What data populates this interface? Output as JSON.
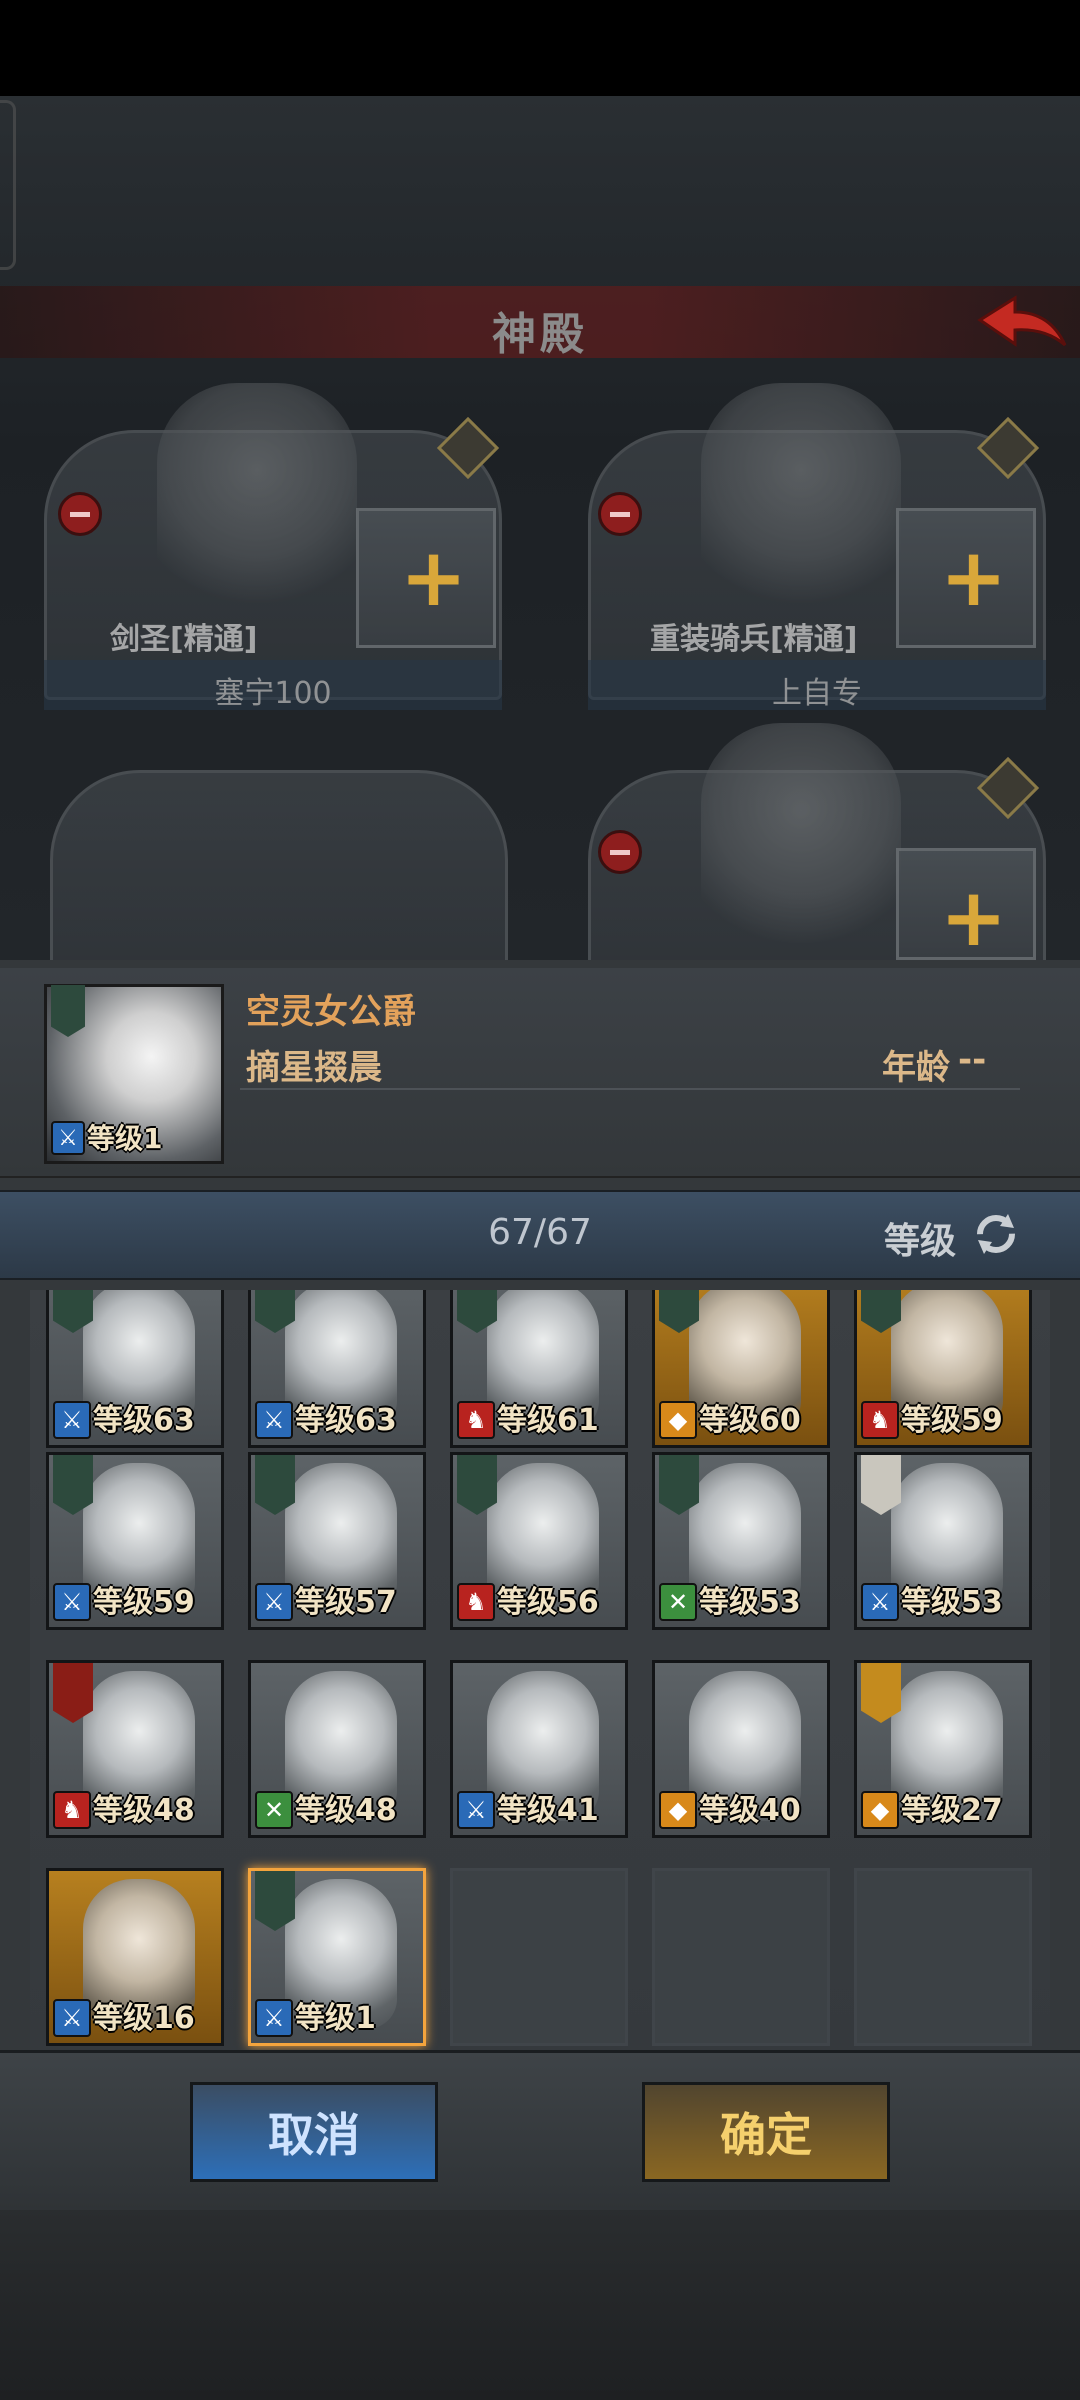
{
  "scene": {
    "title": "神殿",
    "slots": [
      {
        "class_label": "剑圣[精通]",
        "owner": "塞宁100"
      },
      {
        "class_label": "重装骑兵[精通]",
        "owner": "上自专"
      }
    ]
  },
  "selected_hero": {
    "name": "空灵女公爵",
    "title": "摘星掇晨",
    "age_label": "年龄",
    "age_value": "--",
    "level_text": "等级1"
  },
  "list_header": {
    "count": "67/67",
    "sort_label": "等级"
  },
  "heroes": [
    {
      "level": "等级63",
      "class": "sword",
      "bg": "grey",
      "banner": "green",
      "selected": false
    },
    {
      "level": "等级63",
      "class": "sword",
      "bg": "grey",
      "banner": "green",
      "selected": false
    },
    {
      "level": "等级61",
      "class": "horse",
      "bg": "grey",
      "banner": "green",
      "selected": false
    },
    {
      "level": "等级60",
      "class": "shield",
      "bg": "gold",
      "banner": "green",
      "selected": false
    },
    {
      "level": "等级59",
      "class": "horse",
      "bg": "gold",
      "banner": "green",
      "selected": false
    },
    {
      "level": "等级59",
      "class": "sword",
      "bg": "grey",
      "banner": "green",
      "selected": false
    },
    {
      "level": "等级57",
      "class": "sword",
      "bg": "grey",
      "banner": "green",
      "selected": false
    },
    {
      "level": "等级56",
      "class": "horse",
      "bg": "grey",
      "banner": "green",
      "selected": false
    },
    {
      "level": "等级53",
      "class": "bow",
      "bg": "grey",
      "banner": "green",
      "selected": false
    },
    {
      "level": "等级53",
      "class": "sword",
      "bg": "grey",
      "banner": "white",
      "selected": false
    },
    {
      "level": "等级48",
      "class": "horse",
      "bg": "grey",
      "banner": "red",
      "selected": false
    },
    {
      "level": "等级48",
      "class": "bow",
      "bg": "grey",
      "banner": "none",
      "selected": false
    },
    {
      "level": "等级41",
      "class": "sword",
      "bg": "grey",
      "banner": "none",
      "selected": false
    },
    {
      "level": "等级40",
      "class": "shield",
      "bg": "grey",
      "banner": "none",
      "selected": false
    },
    {
      "level": "等级27",
      "class": "shield",
      "bg": "grey",
      "banner": "gold",
      "selected": false
    },
    {
      "level": "等级16",
      "class": "sword",
      "bg": "gold",
      "banner": "none",
      "selected": false
    },
    {
      "level": "等级1",
      "class": "sword",
      "bg": "grey",
      "banner": "green",
      "selected": true
    }
  ],
  "empty_slots": 3,
  "buttons": {
    "cancel": "取消",
    "confirm": "确定"
  },
  "colors": {
    "accent_orange": "#e3a25b",
    "selected_border": "#f4a43d",
    "cancel_blue": "#2d6fb8",
    "confirm_gold": "#f5d06d"
  }
}
